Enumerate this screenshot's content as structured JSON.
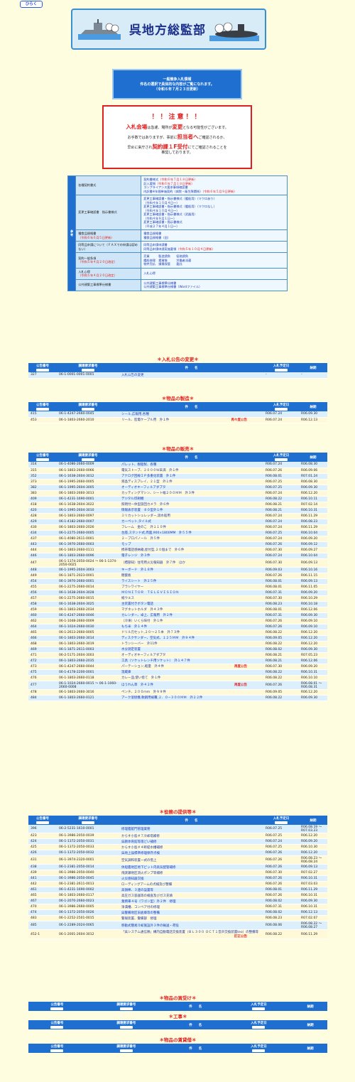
{
  "topbar": {
    "open_label": "ひらく"
  },
  "header": {
    "title": "呉地方総監部"
  },
  "notice": {
    "line1": "一般競争入札情報",
    "line2": "件名の選択で具体的な内容がご覧になれます。",
    "line3": "（令和６年７月２３日更新）"
  },
  "caution": {
    "title": "！！注意！！",
    "l1_red": "入札会場",
    "l1_mid": "は急遽、場所が",
    "l1_red2": "変更",
    "l1_end": "となる可能性がございます。",
    "l2_a": "お手数ではありますが、事前に",
    "l2_red": "担当者へ",
    "l2_b": "ご確認されるか、",
    "l3_a": "早めに来庁され",
    "l3_red": "契約課１F受付",
    "l3_b": "にてご確認されることを",
    "l4": "推奨しております。"
  },
  "reference": {
    "side": "参考",
    "rows": [
      {
        "label": "各種契約書式",
        "links": [
          "契約書様式（令和６年７月１８日更新）",
          "記入要領（令和６年７月１８日更新）",
          "コンプライアンス要求事項確認書",
          "内訳書※年間単価契約（病院・衛生隊関係）（令和６年５月９日更新）"
        ]
      },
      {
        "label": "変更工事確認書　指示書様式",
        "links": [
          "変更工事確認書・指示書様式（艦船用）（マクロあり）",
          "（令和４年１０月４日〜）",
          "変更工事確認書・指示書様式（艦船用）（マクロなし）",
          "（令和４年１０月４日〜）",
          "変更工事確認書・指示書様式（武器用）",
          "（令和４年９月１日〜）",
          "変更工事確認書・指示書様式",
          "（平成２７年４月１日〜）"
        ]
      },
      {
        "label": "種食品規格書　（令和６年６月５日更新）",
        "links": [
          "種食品規格書",
          "種食品規格書（旧）"
        ]
      },
      {
        "label": "同等品申請について（ＦＡＸでの申請は認めない）",
        "links": [
          "同等品申請申請書",
          "同等品申請申請実施要領（令和５年１０月４日更新）"
        ]
      },
      {
        "label": "契約一般条項　（令和５年４月２０日改定）",
        "links": [
          "売買　　　製造請負　　役務請負",
          "艦船修理　賃貸借　　　労働者派遣",
          "物件売払　損傷保管　　委託"
        ]
      },
      {
        "label": "入札心得　（令和５年４月２０日改定）",
        "links": [
          "入札心得"
        ]
      },
      {
        "label": "公共建築工事標準仕様書",
        "links": [
          "公共建築工事標準仕様書",
          "公共建築工事標準仕様書（Wordファイル）"
        ]
      }
    ]
  },
  "columns": {
    "no": "公告番号",
    "req": "調達要求番号",
    "name": "件　　名",
    "date": "入札予定日",
    "due": "納期",
    "sort": "▲"
  },
  "sections": [
    {
      "title": "＊入札公告の変更＊",
      "rows": [
        [
          "327",
          "06-1-0001-0001-0001",
          "入札公告の変更",
          "-",
          "-",
          ""
        ]
      ]
    },
    {
      "title": "＊物品の製造＊",
      "rows": [
        [
          "415",
          "06-1-4247-2660-0045",
          "シール,広報用,各種",
          "R06.07.24",
          "R06.09.30",
          ""
        ],
        [
          "453",
          "06-1-1803-2660-2010",
          "リール、陸電ケーブル用　外１件",
          "R06.07.24",
          "R06.12.13",
          "再々度公告"
        ]
      ]
    },
    {
      "title": "＊物品の販売＊",
      "rows": [
        [
          "314",
          "06-1-4086-2660-0009",
          "パレット、樹脂製、各種",
          "R06.07.24",
          "R06.08.30",
          ""
        ],
        [
          "315",
          "06-1-1803-2660-0066",
          "電気ストーブ、２０００Ｗ未満　外１件",
          "R06.07.26",
          "R06.09.06",
          ""
        ],
        [
          "352",
          "06-1-1638-2604-3012",
          "アナログ回線ＩＰ多重化装置　外１件",
          "R06.08.01",
          "R07.01.24",
          ""
        ],
        [
          "373",
          "06-1-1995-2660-0005",
          "液晶ディスプレイ、２１型　外１件",
          "R06.07.25",
          "R06.08.30",
          ""
        ],
        [
          "382",
          "06-1-1995-2604-3005",
          "オーディオキーフィルアダプタ",
          "R06.07.25",
          "R06.09.30",
          ""
        ],
        [
          "383",
          "06-1-1803-2660-3013",
          "カッティングマシン、シート幅２００ＭＭ　外３件",
          "R06.07.24",
          "R06.12.20",
          ""
        ],
        [
          "409",
          "06-1-4231-1690-0001",
          "デジタル印刷機",
          "R06.08.22",
          "R06.10.11",
          ""
        ],
        [
          "418",
          "06-1-1638-2604-3022",
          "照明付一体型旋回カメラ　外６件",
          "R06.08.21",
          "R07.02.14",
          ""
        ],
        [
          "420",
          "06-1-1995-2604-3010",
          "情報表示装置　８０型外１件",
          "R06.08.21",
          "R06.10.31",
          ""
        ],
        [
          "428",
          "06-1-1803-2660-0097",
          "ミリカットシュレッダー,溶水船用",
          "R06.07.24",
          "R06.11.29",
          ""
        ],
        [
          "429",
          "06-1-4182-2660-0007",
          "カーペット,タイル式",
          "R06.07.24",
          "R06.08.23",
          ""
        ],
        [
          "430",
          "06-1-1803-2660-2026",
          "フレーム　金のこ　外１１０件",
          "R06.07.24",
          "R06.11.29",
          ""
        ],
        [
          "434",
          "06-1-2275-2660-0005",
          "台座,スタンド式,両面,900×1800MM　外５５件",
          "R06.07.25",
          "R06.10.04",
          ""
        ],
        [
          "437",
          "06-1-4080-2611-0001",
          "２－プロパノール　外５件",
          "R06.07.24",
          "R06.09.20",
          ""
        ],
        [
          "443",
          "06-1-3970-2660-0003",
          "モップ",
          "R06.07.26",
          "R06.09.12",
          ""
        ],
        [
          "444",
          "06-1-1803-2660-0111",
          "携帯電話感納箱,屋付型,２０個まで　外６件",
          "R06.07.30",
          "R06.09.27",
          ""
        ],
        [
          "446",
          "06-1-1803-2660-0096",
          "電子レンジ　外３件",
          "R06.07.24",
          "R06.10.04",
          ""
        ],
        [
          "447",
          "06-1-1374-2050-0024 〜 06-1-1374-2050-0025",
          "（標部知）住宅用火災報知器　外７件　ほか",
          "R06.07.30",
          "R06.09.13",
          ""
        ],
        [
          "448",
          "06-1-1995-2604-3003",
          "キーボード　外１８件",
          "R06.09.03",
          "R06.10.16",
          ""
        ],
        [
          "449",
          "06-1-1871-2023-0001",
          "糖蜜板",
          "R06.07.26",
          "R06.11.15",
          ""
        ],
        [
          "454",
          "06-1-3970-2660-0001",
          "ライスシート　外２５件",
          "R06.08.01",
          "R06.09.13",
          ""
        ],
        [
          "455",
          "06-1-2275-2660-0014",
          "ブラシワイヤー",
          "R06.08.01",
          "R06.11.05",
          ""
        ],
        [
          "456",
          "06-1-1638-2604-3028",
          "ＭＯＮＩＴＯＲ　ＴＥＬＥＶＩＳＩＯＮ",
          "R06.07.31",
          "R06.09.20",
          ""
        ],
        [
          "457",
          "06-1-2275-2660-0015",
          "紙ウエス",
          "R06.07.30",
          "R06.10.29",
          ""
        ],
        [
          "458",
          "06-1-1638-2604-3025",
          "主装置付きボタン電話",
          "R06.08.23",
          "R06.10.18",
          ""
        ],
        [
          "459",
          "06-1-1803-2660-2034",
          "マグネットホルダ　外４３件",
          "R06.08.01",
          "R06.12.06",
          ""
        ],
        [
          "460",
          "06-1-4247-2660-0046",
          "カレンダー、卓上、広報用　外２件",
          "R06.07.31",
          "R06.09.30",
          ""
        ],
        [
          "462",
          "06-1-1048-2660-0009",
          "（冷凍）いくら味付　外１件",
          "R06.07.26",
          "R06.09.10",
          ""
        ],
        [
          "464",
          "06-1-1024-2660-0030",
          "もち米　外１４件",
          "R06.07.26",
          "R06.09.10",
          ""
        ],
        [
          "465",
          "06-1-2613-2660-0005",
          "ドリル刃セット,２０〜２５本　外７３件",
          "R06.08.22",
          "R06.12.20",
          ""
        ],
        [
          "466",
          "06-1-1803-2660-3014",
          "ディスクサンダー、空気式、１２５ＭＭ　外９４件",
          "R06.09.05",
          "R06.12.20",
          ""
        ],
        [
          "468",
          "06-1-1803-2660-3019",
          "トランシーバー　外11件",
          "R06.08.22",
          "R06.12.20",
          ""
        ],
        [
          "469",
          "06-1-1871-2611-0003",
          "水分測定装置",
          "R06.08.02",
          "R06.09.30",
          ""
        ],
        [
          "471",
          "06-2-5171-2604-3003",
          "オーディオキーフィルアダプタ",
          "R06.08.21",
          "R07.05.23",
          ""
        ],
        [
          "472",
          "06-1-1803-2660-2035",
          "工具（ソケットレンチ用ソケット）　外１４７件",
          "R06.08.21",
          "R06.12.06",
          ""
        ],
        [
          "473",
          "06-1-4247-2660-0044",
          "パーテーション,軽量　外４件",
          "R06.07.30",
          "R06.09.20",
          "再度公告"
        ],
        [
          "475",
          "06-1-4178-2200-0001",
          "温蔵庫",
          "R06.08.22",
          "R06.10.31",
          ""
        ],
        [
          "476",
          "06-1-1803-2660-0118",
          "カレー皿,使い捨て　外１件",
          "R06.08.22",
          "R06.10.10",
          ""
        ],
        [
          "477",
          "06-1-1024-2660-0015 〜 06-1-1060-2660-0008",
          "ほうれん草　外４２件",
          "R06.07.26",
          "R06.08.01 〜 R06.08.31",
          "再度公告"
        ],
        [
          "478",
          "06-1-1803-2660-3016",
          "ペンチ、２００ｍｍ　外９９件",
          "R06.09.05",
          "R06.12.20",
          ""
        ],
        [
          "484",
          "06-1-1803-2660-0121",
          "アーク溶接機,軟鋼用被覆,２．０−３００ＭＭ　外２２件",
          "R06.08.22",
          "R06.09.30",
          ""
        ]
      ]
    },
    {
      "title": "＊役務の提供等＊",
      "rows": [
        [
          "396",
          "06-2-5231-1610-0001",
          "修理艦艇門管理業務",
          "R06.07.25",
          "R06.08.19 〜 R07.03.23",
          ""
        ],
        [
          "423",
          "06-1-3986-2050-0039",
          "からす小島＃７冷却塔補修",
          "R06.07.25",
          "R06.12.20",
          ""
        ],
        [
          "424",
          "06-1-1372-2050-0031",
          "呉教体育館等雨どい補修",
          "R06.07.24",
          "R06.09.20",
          ""
        ],
        [
          "425",
          "06-1-1372-2050-0033",
          "からす小島＃４断堤水槽補修",
          "R06.07.25",
          "R06.10.30",
          ""
        ],
        [
          "426",
          "06-1-1372-2050-0032",
          "呉地上誤標準修理保存点検",
          "R06.07.26",
          "R06.12.20",
          ""
        ],
        [
          "431",
          "06-1-3974-2320-0001",
          "空気調和装置一式の借上",
          "R06.07.26",
          "R06.08.23 〜 R06.08.24",
          ""
        ],
        [
          "438",
          "06-1-2381-2050-0014",
          "体船艦地区地下ピット内高気配管補修",
          "R06.07.26",
          "R06.09.13",
          ""
        ],
        [
          "439",
          "06-1-3986-2050-0040",
          "飛渡瀬地区消火ポンプ等補修",
          "R06.07.30",
          "R07.02.27",
          ""
        ],
        [
          "441",
          "06-1-3986-2050-0045",
          "火災感知器交換",
          "R06.07.26",
          "R06.10.31",
          ""
        ],
        [
          "442",
          "06-1-2381-2611-0013",
          "ローディングアームの点検及び整備",
          "R06.07.26",
          "R07.03.03",
          ""
        ],
        [
          "461",
          "06-1-4231-1690-0002",
          "高損棒、３連の設置等",
          "R06.08.01",
          "R06.11.29",
          ""
        ],
        [
          "465",
          "06-1-1803-2660-0117",
          "高圧ガス容器等の検査及びガス充填",
          "R06.07.26",
          "R06.10.31",
          ""
        ],
        [
          "467",
          "06-1-2070-2660-0023",
          "業務車４号（ワゴン型）外２件　修理",
          "R06.08.02",
          "R06.09.30",
          ""
        ],
        [
          "470",
          "06-1-3986-2660-0005",
          "浄潰槽、コンベア付の修理",
          "R06.07.31",
          "R06.10.31",
          ""
        ],
        [
          "474",
          "06-1-1372-2050-0026",
          "呉警備地区旧倉庫等の整備",
          "R06.08.02",
          "R06.12.13",
          ""
        ],
        [
          "483",
          "06-1-2252-2501-0015",
          "警報装置、警備部　修理",
          "R06.08.23",
          "R07.02.07",
          ""
        ],
        [
          "485",
          "06-1-2289-2024-0065",
          "移動式簡易冷却施設外３件の輸送・荷役",
          "R06.08.06",
          "R06.08.22 〜 R06.08.27",
          ""
        ],
        [
          "452-1",
          "06-1-2001-2604-3012",
          "「呉システム通信隊」構内自動電話交換装置（ＢＬ３００ ＯＣＴ１音声交換装置teo）の整備等",
          "R06.08.22",
          "R06.11.29",
          "訂正公告"
        ]
      ]
    },
    {
      "title": "＊物品の買受け＊",
      "rows": []
    },
    {
      "title": "＊工事＊",
      "rows": []
    },
    {
      "title": "＊物品の賃貸借＊",
      "rows": []
    }
  ]
}
